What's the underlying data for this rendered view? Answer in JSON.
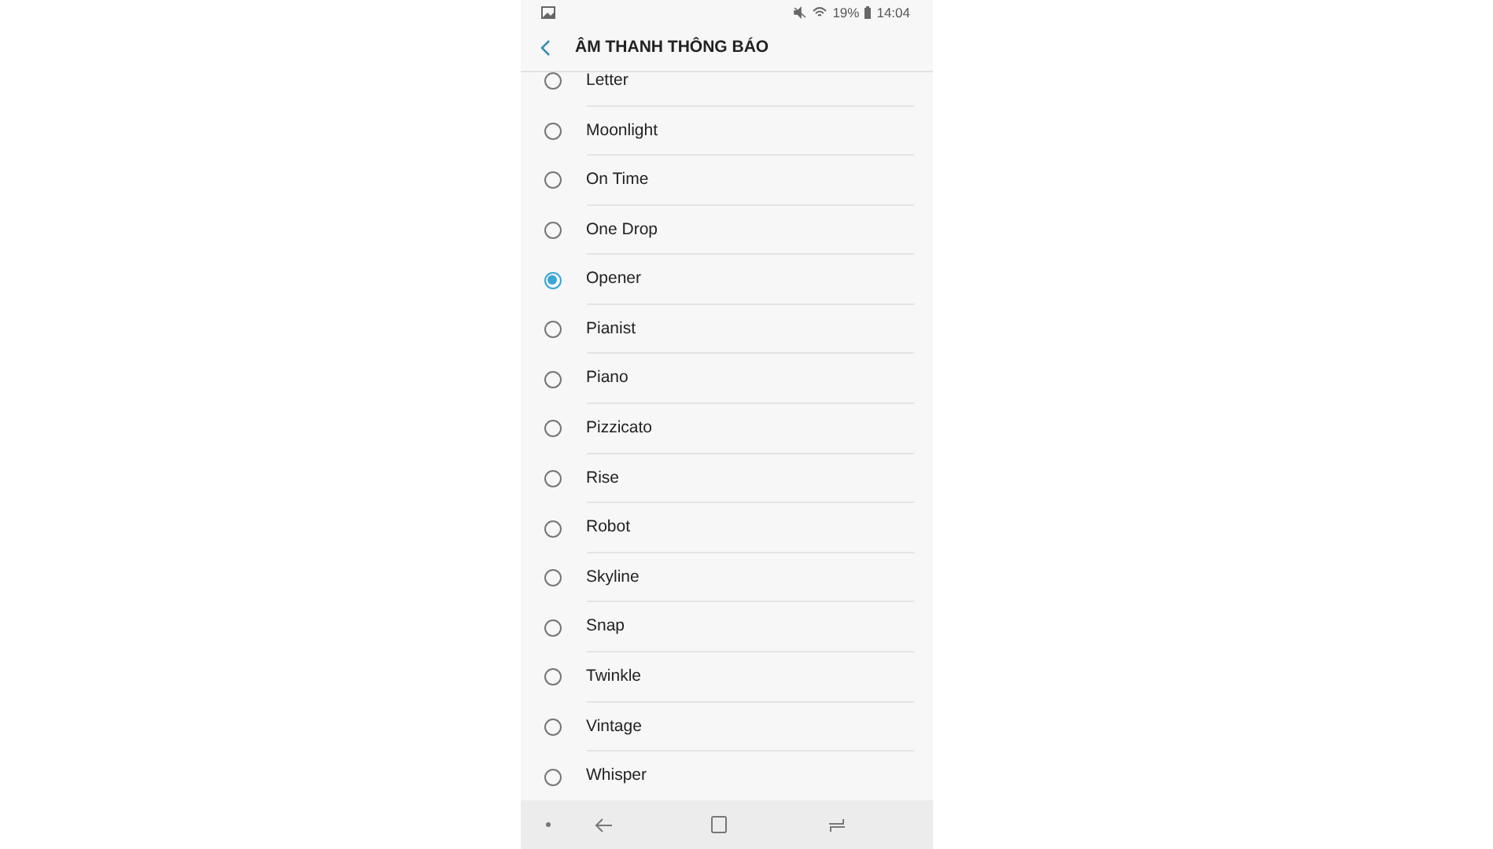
{
  "status_bar": {
    "battery": "19%",
    "time": "14:04"
  },
  "header": {
    "title": "ÂM THANH THÔNG BÁO"
  },
  "sounds": [
    {
      "label": "Letter",
      "selected": false
    },
    {
      "label": "Moonlight",
      "selected": false
    },
    {
      "label": "On Time",
      "selected": false
    },
    {
      "label": "One Drop",
      "selected": false
    },
    {
      "label": "Opener",
      "selected": true
    },
    {
      "label": "Pianist",
      "selected": false
    },
    {
      "label": "Piano",
      "selected": false
    },
    {
      "label": "Pizzicato",
      "selected": false
    },
    {
      "label": "Rise",
      "selected": false
    },
    {
      "label": "Robot",
      "selected": false
    },
    {
      "label": "Skyline",
      "selected": false
    },
    {
      "label": "Snap",
      "selected": false
    },
    {
      "label": "Twinkle",
      "selected": false
    },
    {
      "label": "Vintage",
      "selected": false
    },
    {
      "label": "Whisper",
      "selected": false
    }
  ]
}
